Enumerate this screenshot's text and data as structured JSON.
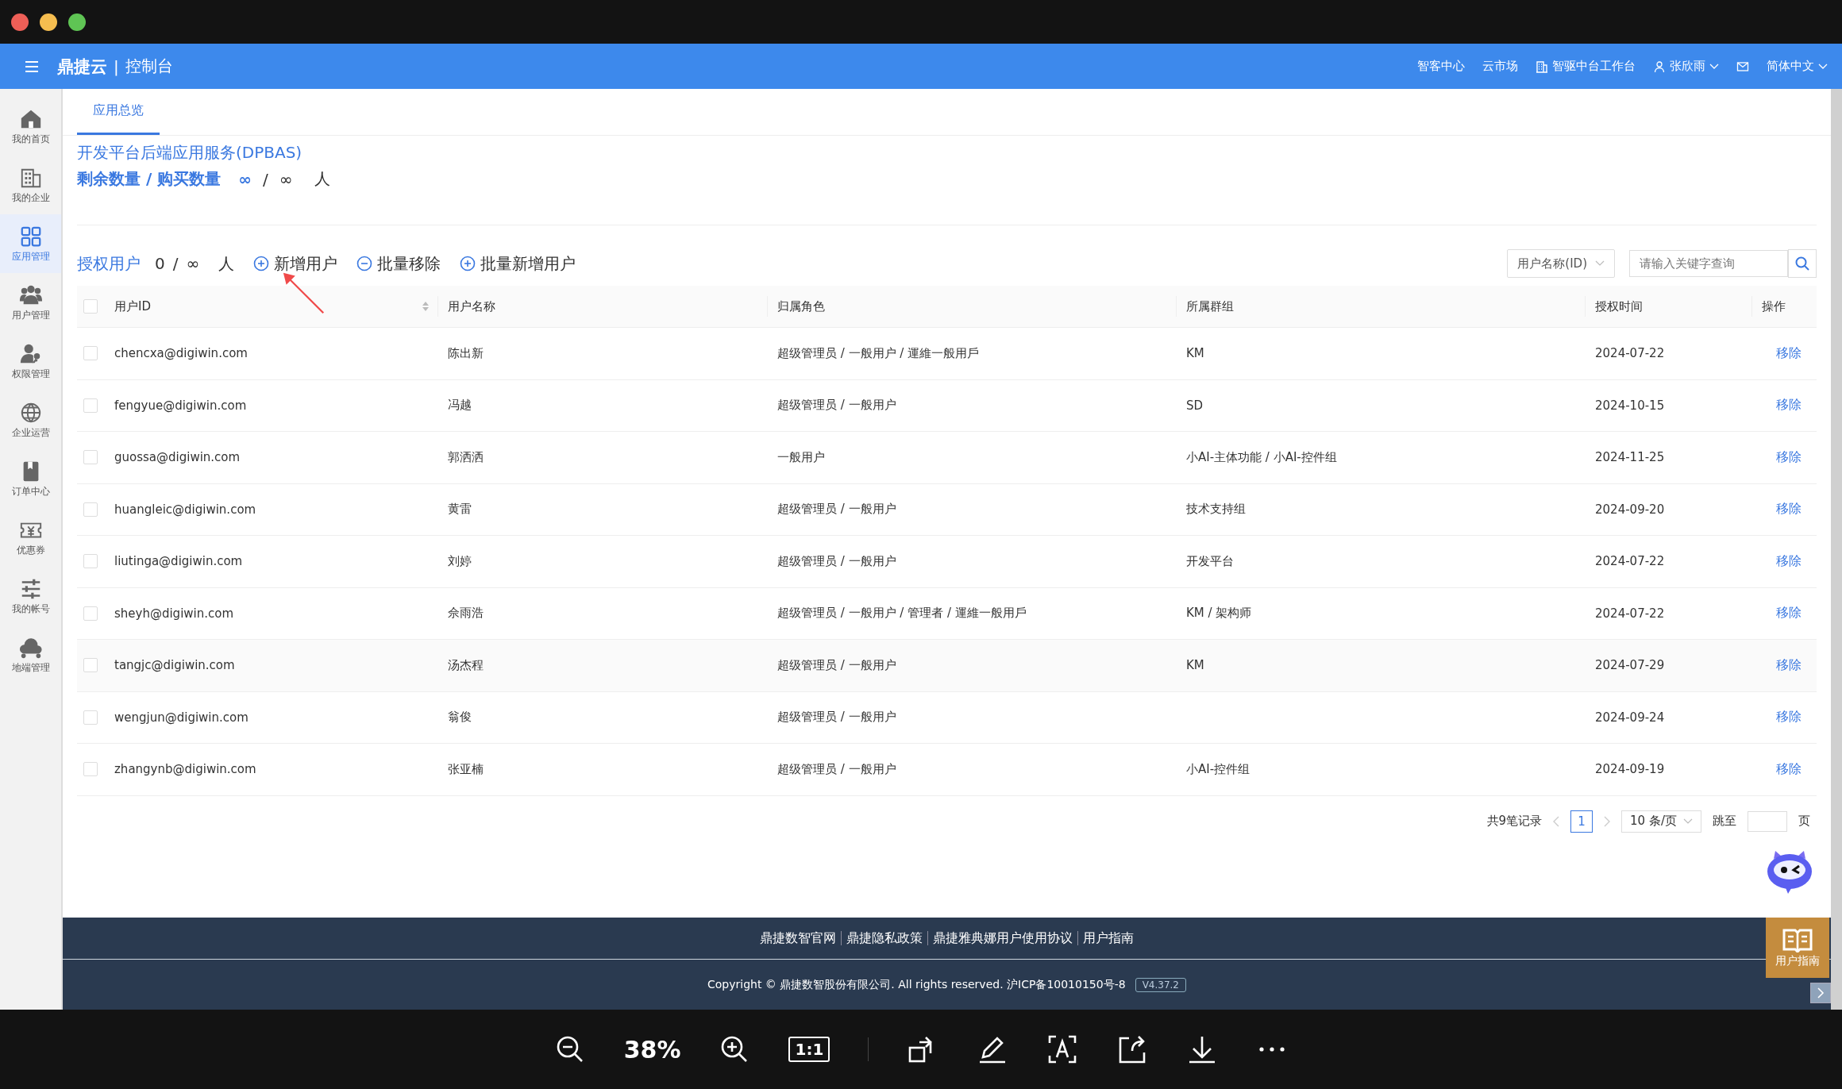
{
  "header": {
    "brand": "鼎捷云",
    "separator": "|",
    "product": "控制台",
    "links": [
      {
        "kind": "text",
        "label": "智客中心"
      },
      {
        "kind": "text",
        "label": "云市场"
      },
      {
        "kind": "building",
        "label": "智驱中台工作台"
      },
      {
        "kind": "user",
        "label": "张欣雨",
        "caret": true
      },
      {
        "kind": "mail"
      },
      {
        "kind": "text",
        "label": "简体中文",
        "caret": true
      }
    ]
  },
  "sidebar": {
    "items": [
      {
        "label": "我的首页",
        "selected": false
      },
      {
        "label": "我的企业",
        "selected": false
      },
      {
        "label": "应用管理",
        "selected": true
      },
      {
        "label": "用户管理",
        "selected": false
      },
      {
        "label": "权限管理",
        "selected": false
      },
      {
        "label": "企业运营",
        "selected": false
      },
      {
        "label": "订单中心",
        "selected": false
      },
      {
        "label": "优惠券",
        "selected": false
      },
      {
        "label": "我的帐号",
        "selected": false
      },
      {
        "label": "地端管理",
        "selected": false
      }
    ]
  },
  "tabs": [
    {
      "label": "应用总览",
      "selected": true
    }
  ],
  "app": {
    "name": "开发平台后端应用服务(DPBAS)",
    "quota_label": "剩余数量 / 购买数量",
    "remaining": "∞",
    "slash": "/",
    "purchased": "∞",
    "unit": "人"
  },
  "toolbar": {
    "label": "授权用户",
    "count": "0",
    "slash": "/",
    "total": "∞",
    "unit": "人",
    "actions": [
      {
        "kind": "add",
        "label": "新增用户"
      },
      {
        "kind": "remove",
        "label": "批量移除"
      },
      {
        "kind": "add",
        "label": "批量新增用户"
      }
    ],
    "filter": "用户名称(ID)",
    "search_placeholder": "请输入关键字查询"
  },
  "table": {
    "columns": [
      "用户ID",
      "用户名称",
      "归属角色",
      "所属群组",
      "授权时间",
      "操作"
    ],
    "all_checked": false,
    "rows": [
      {
        "checked": false,
        "id": "chencxa@digiwin.com",
        "name": "陈出新",
        "roles": "超级管理员 / 一般用户 / 運維一般用戶",
        "group": "KM",
        "date": "2024-07-22",
        "action": "移除"
      },
      {
        "checked": false,
        "id": "fengyue@digiwin.com",
        "name": "冯越",
        "roles": "超级管理员 / 一般用户",
        "group": "SD",
        "date": "2024-10-15",
        "action": "移除"
      },
      {
        "checked": false,
        "id": "guossa@digiwin.com",
        "name": "郭洒洒",
        "roles": "一般用户",
        "group": "小AI-主体功能 / 小AI-控件组",
        "date": "2024-11-25",
        "action": "移除"
      },
      {
        "checked": false,
        "id": "huangleic@digiwin.com",
        "name": "黄雷",
        "roles": "超级管理员 / 一般用户",
        "group": "技术支持组",
        "date": "2024-09-20",
        "action": "移除"
      },
      {
        "checked": false,
        "id": "liutinga@digiwin.com",
        "name": "刘婷",
        "roles": "超级管理员 / 一般用户",
        "group": "开发平台",
        "date": "2024-07-22",
        "action": "移除"
      },
      {
        "checked": false,
        "id": "sheyh@digiwin.com",
        "name": "佘雨浩",
        "roles": "超级管理员 / 一般用户 / 管理者 / 運維一般用戶",
        "group": "KM / 架构师",
        "date": "2024-07-22",
        "action": "移除"
      },
      {
        "checked": false,
        "id": "tangjc@digiwin.com",
        "name": "汤杰程",
        "roles": "超级管理员 / 一般用户",
        "group": "KM",
        "date": "2024-07-29",
        "action": "移除"
      },
      {
        "checked": false,
        "id": "wengjun@digiwin.com",
        "name": "翁俊",
        "roles": "超级管理员 / 一般用户",
        "group": "",
        "date": "2024-09-24",
        "action": "移除"
      },
      {
        "checked": false,
        "id": "zhangynb@digiwin.com",
        "name": "张亚楠",
        "roles": "超级管理员 / 一般用户",
        "group": "小AI-控件组",
        "date": "2024-09-19",
        "action": "移除"
      }
    ]
  },
  "pagination": {
    "total": "共9笔记录",
    "pages": [
      {
        "label": "1",
        "selected": true
      }
    ],
    "page_size": "10 条/页",
    "jump_label": "跳至",
    "page_unit": "页"
  },
  "guide_button": {
    "label": "用户指南"
  },
  "footer": {
    "links": [
      "鼎捷数智官网",
      "鼎捷隐私政策",
      "鼎捷雅典娜用户使用协议",
      "用户指南"
    ],
    "copyright": "Copyright © 鼎捷数智股份有限公司. All rights reserved. 沪ICP备10010150号-8",
    "version": "V4.37.2"
  },
  "viewer": {
    "zoom": "38%",
    "actual_size": "1:1"
  }
}
